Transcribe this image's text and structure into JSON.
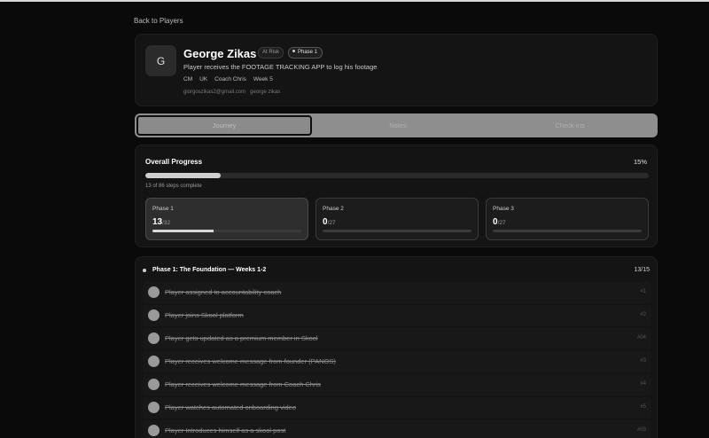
{
  "nav": {
    "back_label": "Back to Players"
  },
  "player": {
    "initial": "G",
    "name": "George Zikas",
    "risk_badge": "At Risk",
    "phase_badge": "Phase 1",
    "description": "Player receives the FOOTAGE TRACKING APP to log his footage",
    "tags": [
      "CM",
      "UK",
      "Coach Chris",
      "Week 5"
    ],
    "email": "giorgoszikas2@gmail.com",
    "username": "george zikas"
  },
  "tabs": [
    {
      "label": "Journey",
      "active": true
    },
    {
      "label": "Notes",
      "active": false
    },
    {
      "label": "Check-ins",
      "active": false
    }
  ],
  "progress": {
    "title": "Overall Progress",
    "percent_label": "15%",
    "percent": 15,
    "subtitle": "13 of 86 steps complete",
    "phases": [
      {
        "label": "Phase 1",
        "done": "13",
        "total": "/32",
        "fraction": 0.41,
        "active": true
      },
      {
        "label": "Phase 2",
        "done": "0",
        "total": "/27",
        "fraction": 0,
        "active": false
      },
      {
        "label": "Phase 3",
        "done": "0",
        "total": "/27",
        "fraction": 0,
        "active": false
      }
    ]
  },
  "section": {
    "title": "Phase 1: The Foundation — Weeks 1-2",
    "count": "13/15",
    "steps": [
      {
        "label": "Player assigned to accountability coach",
        "num": "#1"
      },
      {
        "label": "Player joins Skool platform",
        "num": "#2"
      },
      {
        "label": "Player gets updated as a premium member in Skool",
        "num": "#04"
      },
      {
        "label": "Player receives welcome message from founder (PANOS)",
        "num": "#3"
      },
      {
        "label": "Player receives welcome message from Coach Chris",
        "num": "#4"
      },
      {
        "label": "Player watches automated onboarding video",
        "num": "#5"
      },
      {
        "label": "Player Introduces himself as a skool post",
        "num": "#03"
      }
    ]
  }
}
